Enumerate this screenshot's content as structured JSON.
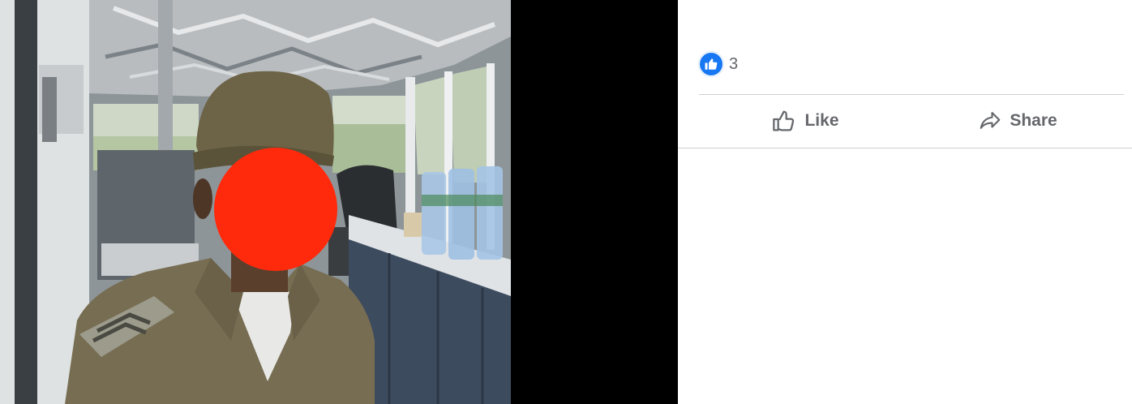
{
  "photo": {
    "alt_subject": "soldier-photo"
  },
  "reactions": {
    "like_count": "3",
    "icon": "thumbs-up-icon",
    "color": "#1877f2"
  },
  "actions": {
    "like_label": "Like",
    "share_label": "Share"
  },
  "colors": {
    "text_secondary": "#65676b",
    "divider": "#ced0d4",
    "viewer_bg": "#000000"
  }
}
